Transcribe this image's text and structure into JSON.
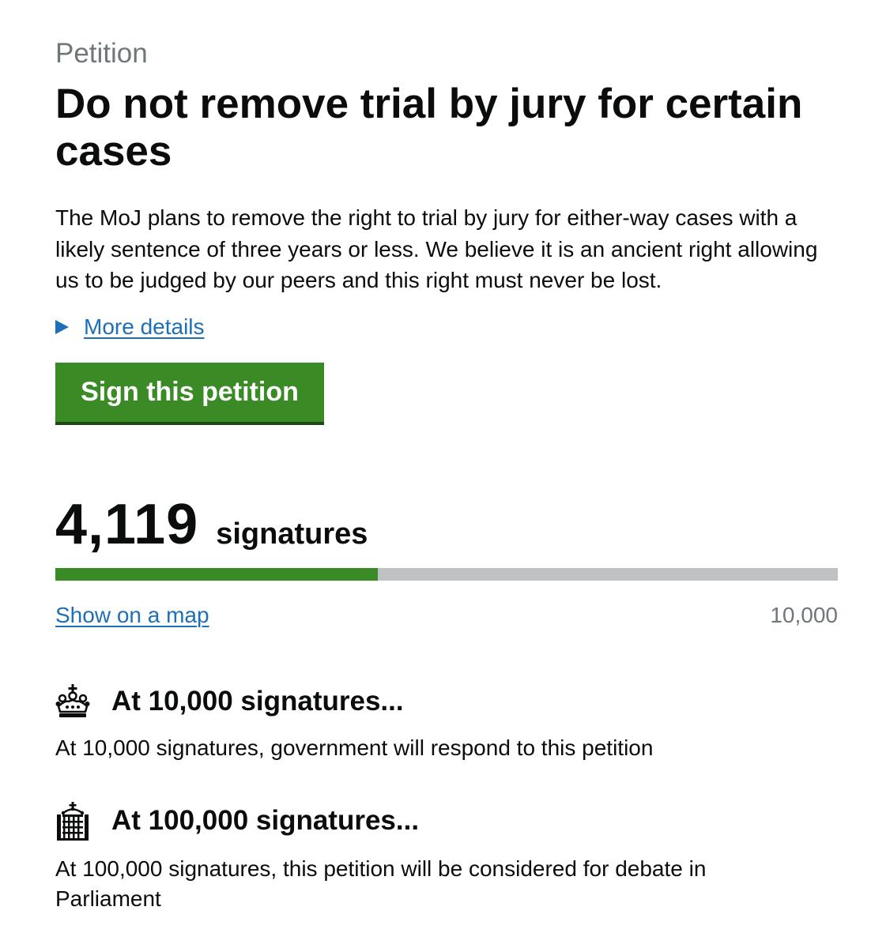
{
  "petition": {
    "eyebrow": "Petition",
    "title": "Do not remove trial by jury for certain cases",
    "summary": "The MoJ plans to remove the right to trial by jury for either-way cases with a likely sentence of three years or less. We believe it is an ancient right allowing us to be judged by our peers and this right must never be lost.",
    "more_details_label": "More details",
    "sign_button_label": "Sign this petition"
  },
  "signatures": {
    "count": "4,119",
    "label": "signatures",
    "goal": "10,000",
    "progress_fraction": 0.4119,
    "show_map_label": "Show on a map"
  },
  "thresholds": [
    {
      "icon": "crown-icon",
      "title": "At 10,000 signatures...",
      "text": "At 10,000 signatures, government will respond to this petition"
    },
    {
      "icon": "portcullis-icon",
      "title": "At 100,000 signatures...",
      "text": "At 100,000 signatures, this petition will be considered for debate in Parliament"
    }
  ],
  "colors": {
    "primary_green": "#3a8b25",
    "link_blue": "#1d70b8",
    "secondary_text": "#6f777b",
    "progress_track": "#bfc1c3",
    "text": "#0b0c0c"
  }
}
